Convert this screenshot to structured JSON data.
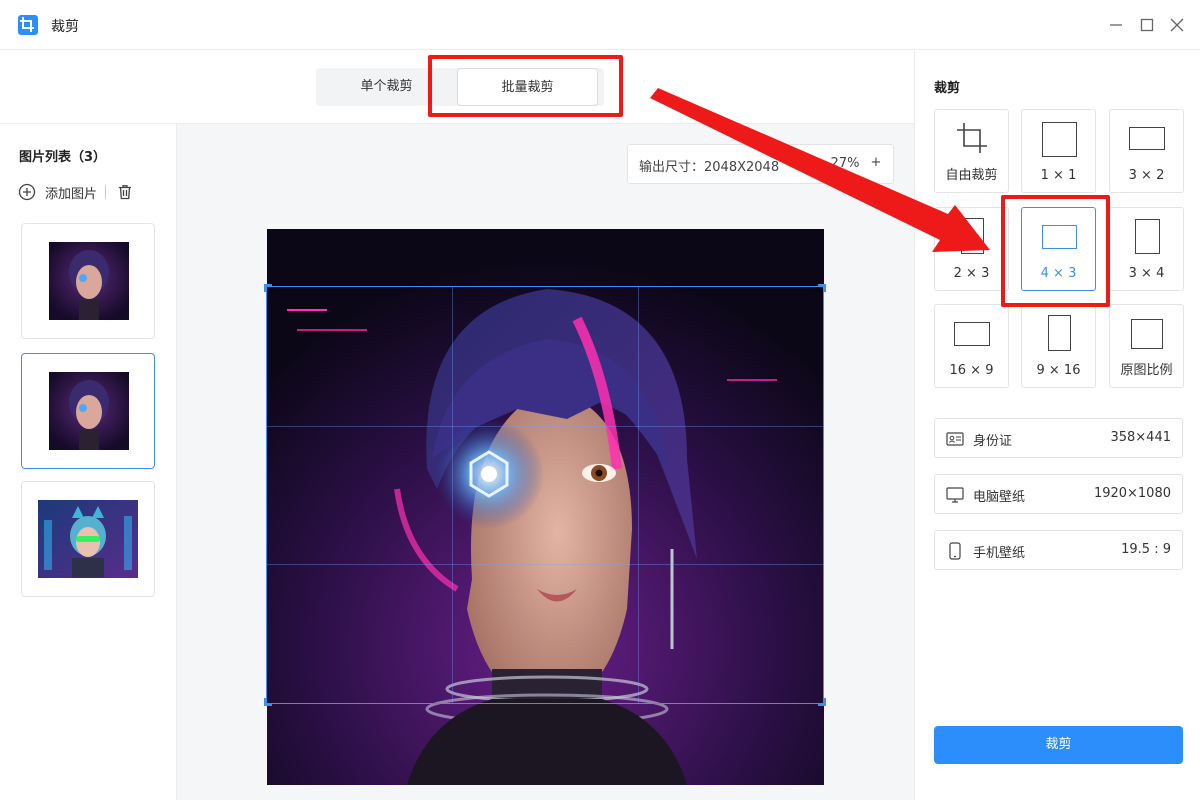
{
  "window": {
    "title": "裁剪",
    "icons": [
      "crop-icon",
      "minimize-icon",
      "maximize-icon",
      "close-icon"
    ]
  },
  "tabs": {
    "single": "单个裁剪",
    "batch": "批量裁剪",
    "active": "批量裁剪"
  },
  "image_list": {
    "title": "图片列表（3）",
    "add_label": "添加图片",
    "selected_index": 1,
    "count": 3
  },
  "canvas": {
    "size_label": "输出尺寸：",
    "size_value": "2048X2048",
    "zoom_minus": "-",
    "zoom_value": "27%",
    "zoom_plus": "+"
  },
  "crop_panel": {
    "title": "裁剪",
    "ratios": [
      {
        "label": "自由裁剪",
        "icon": "crop-icon"
      },
      {
        "label": "1 × 1"
      },
      {
        "label": "3 × 2"
      },
      {
        "label": "2 × 3"
      },
      {
        "label": "4 × 3"
      },
      {
        "label": "3 × 4"
      },
      {
        "label": "16 × 9"
      },
      {
        "label": "9 × 16"
      },
      {
        "label": "原图比例"
      }
    ],
    "selected_ratio": "4 × 3",
    "presets": [
      {
        "name": "身份证",
        "value": "358×441",
        "icon": "id-card-icon"
      },
      {
        "name": "电脑壁纸",
        "value": "1920×1080",
        "icon": "monitor-icon"
      },
      {
        "name": "手机壁纸",
        "value": "19.5 : 9",
        "icon": "phone-icon"
      }
    ],
    "action_label": "裁剪"
  },
  "colors": {
    "accent": "#2b8efb",
    "selection": "#3f8ef0",
    "annotation": "#ee1a1a"
  }
}
